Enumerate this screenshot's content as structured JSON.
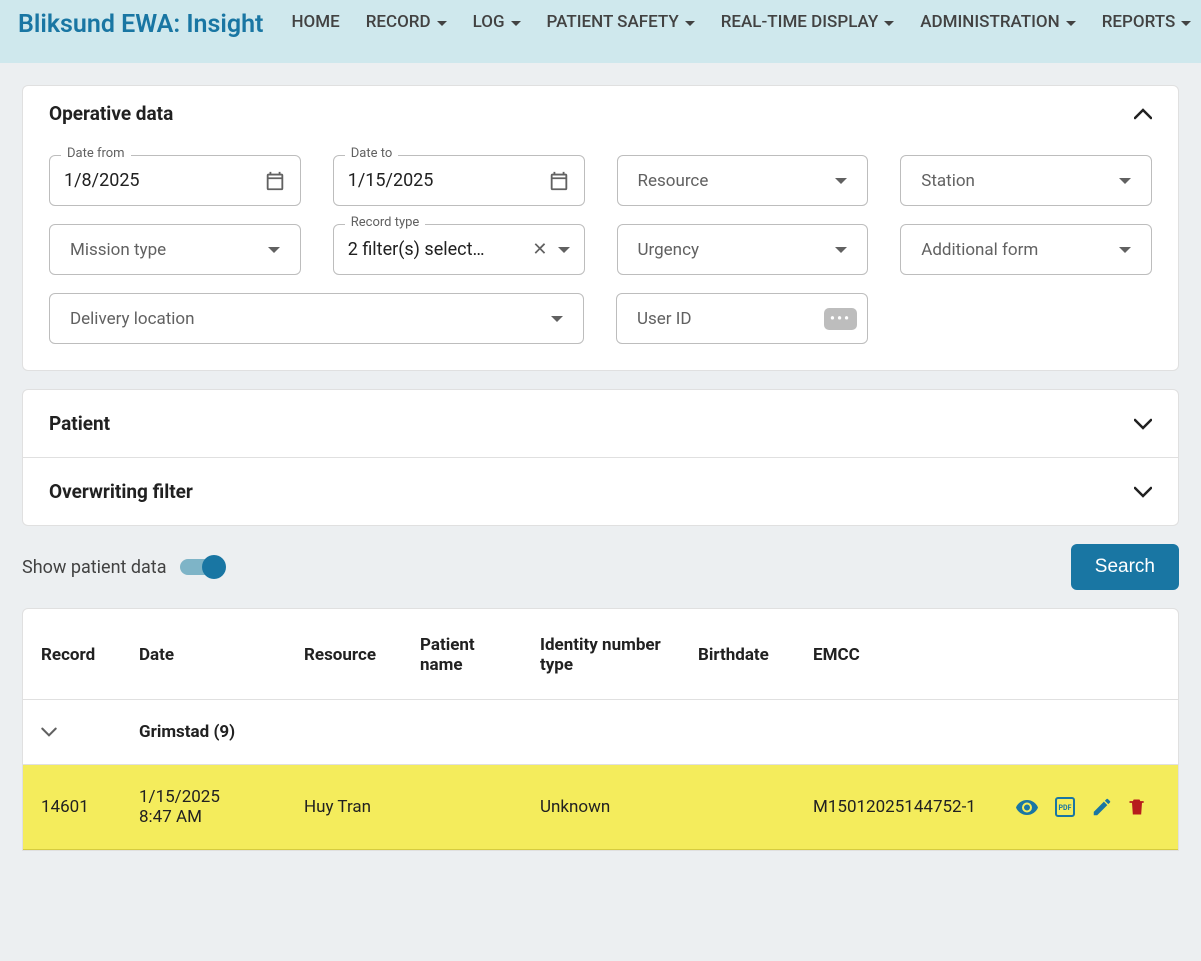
{
  "navbar": {
    "brand": "Bliksund EWA: Insight",
    "items": [
      "HOME",
      "RECORD",
      "LOG",
      "PATIENT SAFETY",
      "REAL-TIME DISPLAY",
      "ADMINISTRATION",
      "REPORTS"
    ],
    "items_dropdown": [
      false,
      true,
      true,
      true,
      true,
      true,
      true
    ]
  },
  "operative": {
    "title": "Operative data",
    "date_from_label": "Date from",
    "date_from": "1/8/2025",
    "date_to_label": "Date to",
    "date_to": "1/15/2025",
    "resource": "Resource",
    "station": "Station",
    "mission_type": "Mission type",
    "record_type_label": "Record type",
    "record_type_text": "2 filter(s) select…",
    "urgency": "Urgency",
    "additional_form": "Additional form",
    "delivery_location": "Delivery location",
    "user_id": "User ID"
  },
  "sections": {
    "patient": "Patient",
    "overwriting": "Overwriting filter"
  },
  "controls": {
    "show_patient_data": "Show patient data",
    "search": "Search"
  },
  "table": {
    "headers": {
      "record": "Record",
      "date": "Date",
      "resource": "Resource",
      "patient_name": "Patient name",
      "identity_type": "Identity number type",
      "birthdate": "Birthdate",
      "emcc": "EMCC"
    },
    "group": {
      "name": "Grimstad",
      "count": "(9)"
    },
    "rows": [
      {
        "record": "14601",
        "date1": "1/15/2025",
        "date2": "8:47 AM",
        "resource": "Huy Tran",
        "identity_type": "Unknown",
        "emcc": "M15012025144752-1"
      }
    ]
  }
}
